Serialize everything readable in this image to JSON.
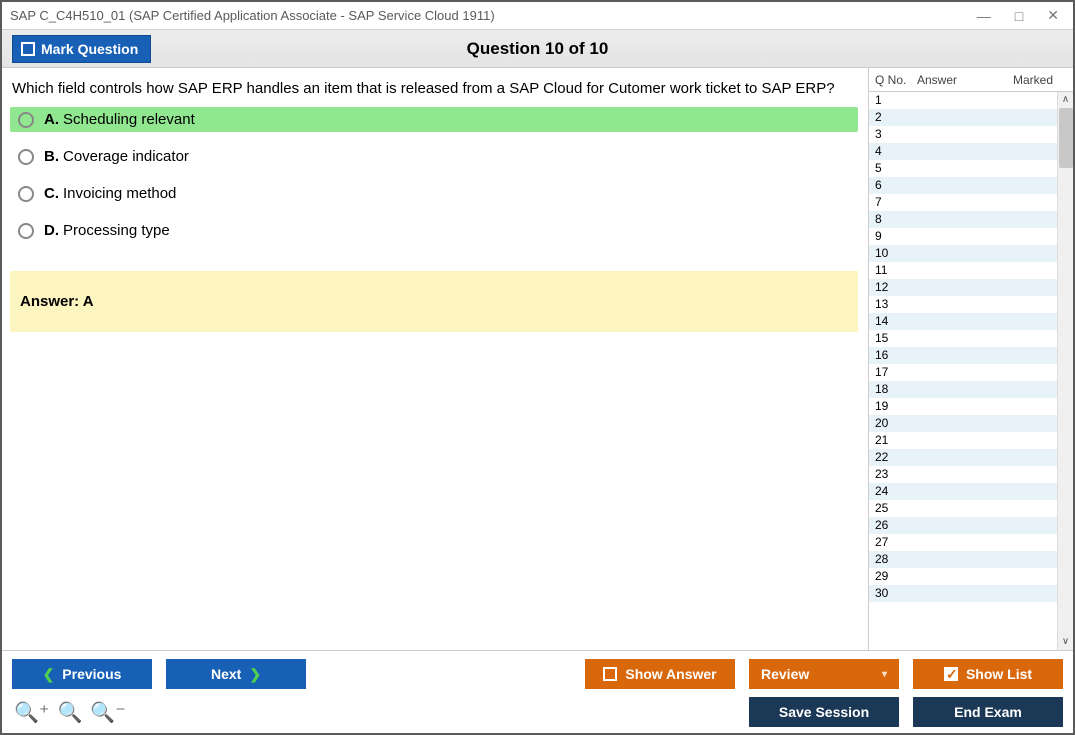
{
  "window": {
    "title": "SAP C_C4H510_01 (SAP Certified Application Associate - SAP Service Cloud 1911)"
  },
  "header": {
    "mark_label": "Mark Question",
    "title": "Question 10 of 10"
  },
  "question": {
    "text": "Which field controls how SAP ERP handles an item that is released from a SAP Cloud for Cutomer work ticket to SAP ERP?",
    "options": [
      {
        "letter": "A.",
        "text": "Scheduling relevant",
        "correct": true
      },
      {
        "letter": "B.",
        "text": "Coverage indicator",
        "correct": false
      },
      {
        "letter": "C.",
        "text": "Invoicing method",
        "correct": false
      },
      {
        "letter": "D.",
        "text": "Processing type",
        "correct": false
      }
    ],
    "answer_label": "Answer: A"
  },
  "sidebar": {
    "columns": [
      "Q No.",
      "Answer",
      "Marked"
    ],
    "rows": [
      1,
      2,
      3,
      4,
      5,
      6,
      7,
      8,
      9,
      10,
      11,
      12,
      13,
      14,
      15,
      16,
      17,
      18,
      19,
      20,
      21,
      22,
      23,
      24,
      25,
      26,
      27,
      28,
      29,
      30
    ]
  },
  "footer": {
    "previous": "Previous",
    "next": "Next",
    "show_answer": "Show Answer",
    "review": "Review",
    "show_list": "Show List",
    "save_session": "Save Session",
    "end_exam": "End Exam"
  }
}
